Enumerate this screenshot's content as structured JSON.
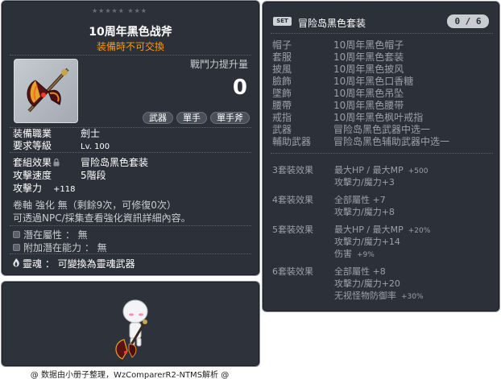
{
  "item_code": "01312155",
  "item": {
    "stars": "★★★★★  ★★★",
    "name": "10周年黑色战斧",
    "trade_notice": "装備時不可交換",
    "power_label": "戰鬥力提升量",
    "power_value": "0",
    "tags": [
      "武器",
      "單手",
      "單手斧"
    ]
  },
  "stats": {
    "job_label": "装備職業",
    "job_value": "劍士",
    "level_label": "要求等級",
    "level_value": "Lv. 100",
    "set_label": "套組效果",
    "set_value": "冒险岛黑色套装",
    "speed_label": "攻擊速度",
    "speed_value": "5階段",
    "attack_label": "攻擊力",
    "attack_value": "+118"
  },
  "scroll": {
    "line1": "卷軸 強化 無（剩餘9次，可修復0次）",
    "line2": "可透過NPC/採集查看強化資訊詳細內容。"
  },
  "potential": {
    "pot_label": "潛在屬性",
    "pot_value": "無",
    "add_label": "附加潛在能力",
    "add_value": "無"
  },
  "soul": {
    "label": "靈魂",
    "value": "可變換為靈魂武器"
  },
  "set": {
    "badge": "SET",
    "name": "冒险岛黑色套装",
    "count": "0 / 6",
    "pieces": [
      {
        "slot": "帽子",
        "name": "10周年黑色帽子"
      },
      {
        "slot": "套服",
        "name": "10周年黑色套装"
      },
      {
        "slot": "披風",
        "name": "10周年黑色披风"
      },
      {
        "slot": "臉飾",
        "name": "10周年黑色口香糖"
      },
      {
        "slot": "墜飾",
        "name": "10周年黑色吊坠"
      },
      {
        "slot": "腰帶",
        "name": "10周年黑色腰带"
      },
      {
        "slot": "戒指",
        "name": "10周年黑色枫叶戒指"
      },
      {
        "slot": "武器",
        "name": "冒险岛黑色武器中选一"
      },
      {
        "slot": "輔助武器",
        "name": "冒险岛黑色辅助武器中选一"
      }
    ],
    "bonuses": [
      {
        "head": "3套裝效果",
        "lines": [
          {
            "text": "最大HP / 最大MP",
            "val": "+500"
          },
          {
            "text": "攻擊力/魔力+3",
            "val": ""
          }
        ]
      },
      {
        "head": "4套裝效果",
        "lines": [
          {
            "text": "全部屬性 +7",
            "val": ""
          },
          {
            "text": "攻擊力/魔力+8",
            "val": ""
          }
        ]
      },
      {
        "head": "5套裝效果",
        "lines": [
          {
            "text": "最大HP / 最大MP",
            "val": "+20%"
          },
          {
            "text": "攻擊力/魔力+14",
            "val": ""
          },
          {
            "text": "伤害",
            "val": "+9%"
          }
        ]
      },
      {
        "head": "6套裝效果",
        "lines": [
          {
            "text": "全部屬性 +8",
            "val": ""
          },
          {
            "text": "攻擊力/魔力+20",
            "val": ""
          },
          {
            "text": "无视怪物防御率",
            "val": "+30%"
          }
        ]
      }
    ]
  },
  "credit": "@ 数据由小册子整理，WzComparerR2-NTMS解析 @",
  "colors": {
    "panel_bg": "#2c3139",
    "trade_orange": "#ff9a00",
    "muted_text": "#9ba0a8"
  }
}
